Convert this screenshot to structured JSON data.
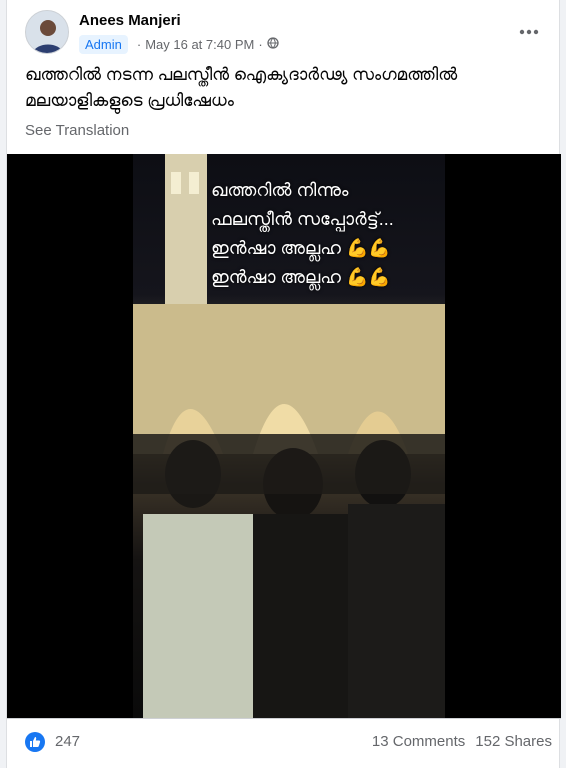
{
  "post": {
    "author": "Anees Manjeri",
    "role_badge": "Admin",
    "separator": "·",
    "date": "May 16 at 7:40 PM",
    "separator2": "·",
    "privacy_icon": "globe-icon",
    "more_icon": "more-horizontal-icon",
    "text": "ഖത്തറിൽ നടന്ന പലസ്തീൻ ഐക്യദാർഢ്യ സംഗമത്തിൽ മലയാളികളുടെ പ്രധിഷേധം",
    "see_translation": "See Translation"
  },
  "video": {
    "overlay_lines": [
      "ഖത്തറിൽ നിന്നും",
      "ഫലസ്തീൻ സപ്പോർട്ട്...",
      "ഇൻഷാ അല്ലഹ 💪💪",
      "ഇൻഷാ അല്ലഹ 💪💪"
    ]
  },
  "footer": {
    "reaction_icon": "like-icon",
    "reactions": "247",
    "comments": "13 Comments",
    "shares": "152 Shares"
  },
  "colors": {
    "accent": "#1877f2",
    "secondary_text": "#65676b",
    "badge_bg": "#e7f3ff"
  }
}
